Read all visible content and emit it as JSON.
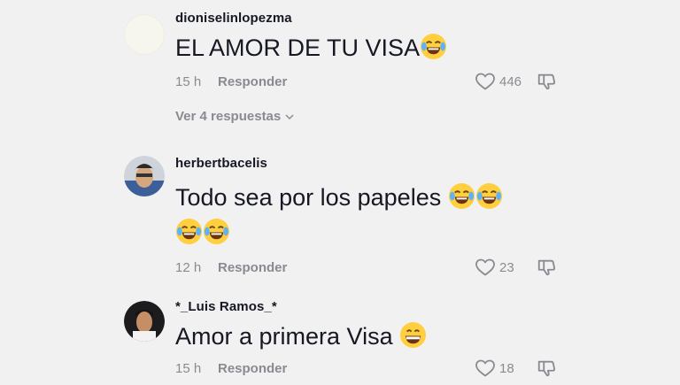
{
  "comments": [
    {
      "username": "dioniselinlopezma",
      "text": "EL AMOR DE TU VISA",
      "emoji": [
        "laughing-tears-emoji"
      ],
      "time": "15 h",
      "reply_label": "Responder",
      "likes": "446",
      "view_replies": "Ver 4 respuestas"
    },
    {
      "username": "herbertbacelis",
      "text": "Todo sea por los papeles",
      "emoji": [
        "laughing-tears-emoji",
        "laughing-tears-emoji",
        "laughing-tears-emoji",
        "laughing-tears-emoji"
      ],
      "time": "12 h",
      "reply_label": "Responder",
      "likes": "23"
    },
    {
      "username": "*_Luis Ramos_*",
      "text": "Amor a primera Visa",
      "emoji": [
        "grinning-emoji"
      ],
      "time": "15 h",
      "reply_label": "Responder",
      "likes": "18"
    }
  ],
  "colors": {
    "background": "#f1f1f2",
    "text_primary": "#161823",
    "text_secondary": "#8a8b91"
  }
}
